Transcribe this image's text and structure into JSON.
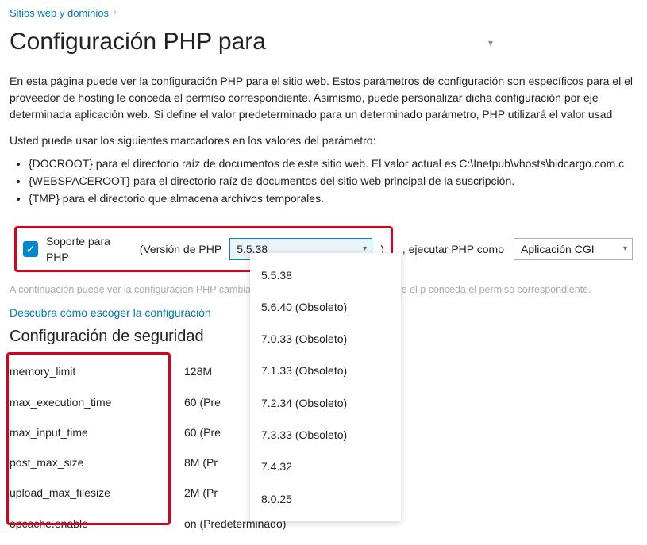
{
  "breadcrumb": {
    "label": "Sitios web y dominios"
  },
  "title": "Configuración PHP para",
  "intro": "En esta página puede ver la configuración PHP para el sitio web. Estos parámetros de configuración son específicos para el el proveedor de hosting le conceda el permiso correspondiente. Asimismo, puede personalizar dicha configuración por eje determinada aplicación web. Si define el valor predeterminado para un determinado parámetro, PHP utilizará el valor usad",
  "markers_intro": "Usted puede usar los siguientes marcadores en los valores del parámetro:",
  "markers": [
    "{DOCROOT} para el directorio raíz de documentos de este sitio web. El valor actual es C:\\Inetpub\\vhosts\\bidcargo.com.c",
    "{WEBSPACEROOT} para el directorio raíz de documentos del sitio web principal de la suscripción.",
    "{TMP} para el directorio que almacena archivos temporales."
  ],
  "support": {
    "label": "Soporte para PHP",
    "version_label": "(Versión de PHP",
    "selected": "5.5.38",
    "close_paren": ")",
    "after": ", ejecutar PHP como",
    "runas_selected": "Aplicación CGI",
    "options": [
      "5.5.38",
      "5.6.40 (Obsoleto)",
      "7.0.33 (Obsoleto)",
      "7.1.33 (Obsoleto)",
      "7.2.34 (Obsoleto)",
      "7.3.33 (Obsoleto)",
      "7.4.32",
      "8.0.25"
    ]
  },
  "faded": "A continuación puede ver la configuración PHP cambiar la configuración PHP siempre que el p conceda el permiso correspondiente.",
  "link": "Descubra cómo escoger la configuración",
  "security_h": "Configuración de seguridad",
  "settings": [
    {
      "name": "memory_limit",
      "value": "128M"
    },
    {
      "name": "max_execution_time",
      "value": "60 (Pre"
    },
    {
      "name": "max_input_time",
      "value": "60 (Pre"
    },
    {
      "name": "post_max_size",
      "value": "8M (Pr"
    },
    {
      "name": "upload_max_filesize",
      "value": "2M (Pr"
    },
    {
      "name": "opcache.enable",
      "value": "on (Predeterminado)"
    }
  ]
}
